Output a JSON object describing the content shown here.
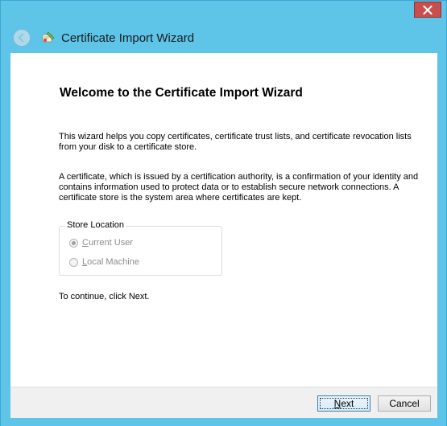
{
  "window": {
    "close_icon": "close-x-icon",
    "title_bar_color": "#5ec4e8",
    "close_color": "#c7504f"
  },
  "header": {
    "back_icon": "back-arrow-icon",
    "wizard_icon": "certificate-wizard-icon",
    "title": "Certificate Import Wizard"
  },
  "main": {
    "heading": "Welcome to the Certificate Import Wizard",
    "intro": "This wizard helps you copy certificates, certificate trust lists, and certificate revocation lists from your disk to a certificate store.",
    "definition": "A certificate, which is issued by a certification authority, is a confirmation of your identity and contains information used to protect data or to establish secure network connections. A certificate store is the system area where certificates are kept.",
    "store_location": {
      "label": "Store Location",
      "options": [
        {
          "accel": "C",
          "rest": "urrent User",
          "checked": true,
          "enabled": false
        },
        {
          "accel": "L",
          "rest": "ocal Machine",
          "checked": false,
          "enabled": false
        }
      ]
    },
    "continue_text": "To continue, click Next."
  },
  "footer": {
    "next": {
      "accel": "N",
      "rest": "ext"
    },
    "cancel": "Cancel"
  }
}
